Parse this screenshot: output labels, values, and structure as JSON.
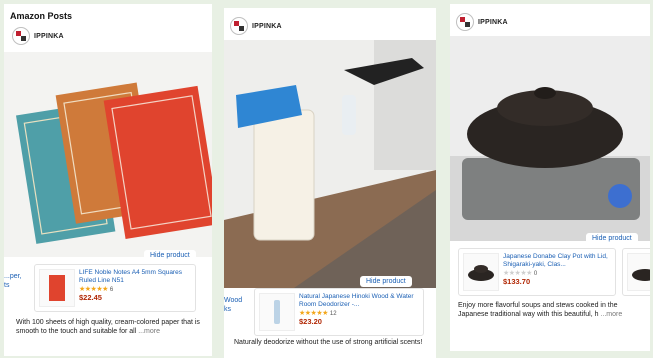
{
  "section_title": "Amazon Posts",
  "posts": [
    {
      "brand": "IPPINKA",
      "hide_label": "Hide product",
      "left_edge": "...per,\nts",
      "product": {
        "title": "LIFE Noble Notes A4 5mm Squares Ruled Line N51",
        "stars": "★★★★★",
        "rating_count": "6",
        "price": "$22.45"
      },
      "caption": "With 100 sheets of high quality, cream-colored paper that is smooth to the touch and suitable for all",
      "more": "...more"
    },
    {
      "brand": "IPPINKA",
      "hide_label": "Hide product",
      "left_edge": "Wood\nks",
      "product": {
        "title": "Natural Japanese Hinoki Wood & Water Room Deodorizer -...",
        "stars": "★★★★★",
        "rating_count": "12",
        "price": "$23.20"
      },
      "caption": "Naturally deodorize without the use of strong artificial scents!"
    },
    {
      "brand": "IPPINKA",
      "hide_label": "Hide product",
      "product": {
        "title": "Japanese Donabe Clay Pot with Lid, Shigaraki-yaki, Clas...",
        "stars": "★★★★★",
        "rating_count": "0",
        "price": "$133.70"
      },
      "caption": "Enjoy more flavorful soups and stews cooked in the Japanese traditional way with this beautiful, h",
      "more": "...more"
    }
  ],
  "colors": {
    "link": "#1a5fb4",
    "price": "#b12704",
    "star": "#f3a71b",
    "background": "#e8f0e4"
  },
  "icons": [
    "ippinka-logo-icon"
  ]
}
